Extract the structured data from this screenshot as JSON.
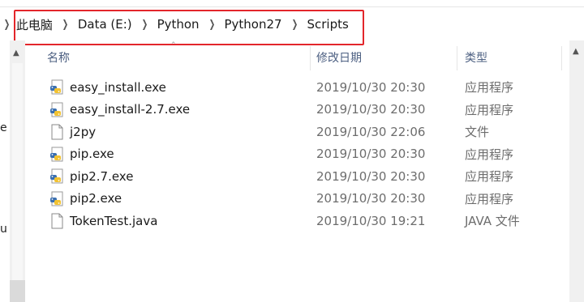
{
  "breadcrumb": {
    "items": [
      "此电脑",
      "Data (E:)",
      "Python",
      "Python27",
      "Scripts"
    ]
  },
  "columns": {
    "name": "名称",
    "date": "修改日期",
    "type": "类型"
  },
  "files": [
    {
      "name": "easy_install.exe",
      "date": "2019/10/30 20:30",
      "type": "应用程序",
      "icon": "python-exe-icon"
    },
    {
      "name": "easy_install-2.7.exe",
      "date": "2019/10/30 20:30",
      "type": "应用程序",
      "icon": "python-exe-icon"
    },
    {
      "name": "j2py",
      "date": "2019/10/30 22:06",
      "type": "文件",
      "icon": "blank-file-icon"
    },
    {
      "name": "pip.exe",
      "date": "2019/10/30 20:30",
      "type": "应用程序",
      "icon": "python-exe-icon"
    },
    {
      "name": "pip2.7.exe",
      "date": "2019/10/30 20:30",
      "type": "应用程序",
      "icon": "python-exe-icon"
    },
    {
      "name": "pip2.exe",
      "date": "2019/10/30 20:30",
      "type": "应用程序",
      "icon": "python-exe-icon"
    },
    {
      "name": "TokenTest.java",
      "date": "2019/10/30 19:21",
      "type": "JAVA 文件",
      "icon": "blank-file-icon"
    }
  ],
  "nav_pane": {
    "fragment_1": "e",
    "fragment_2": "u"
  },
  "colors": {
    "highlight": "#e3262b",
    "header_text": "#4d6082",
    "meta_text": "#6d6d6d"
  }
}
